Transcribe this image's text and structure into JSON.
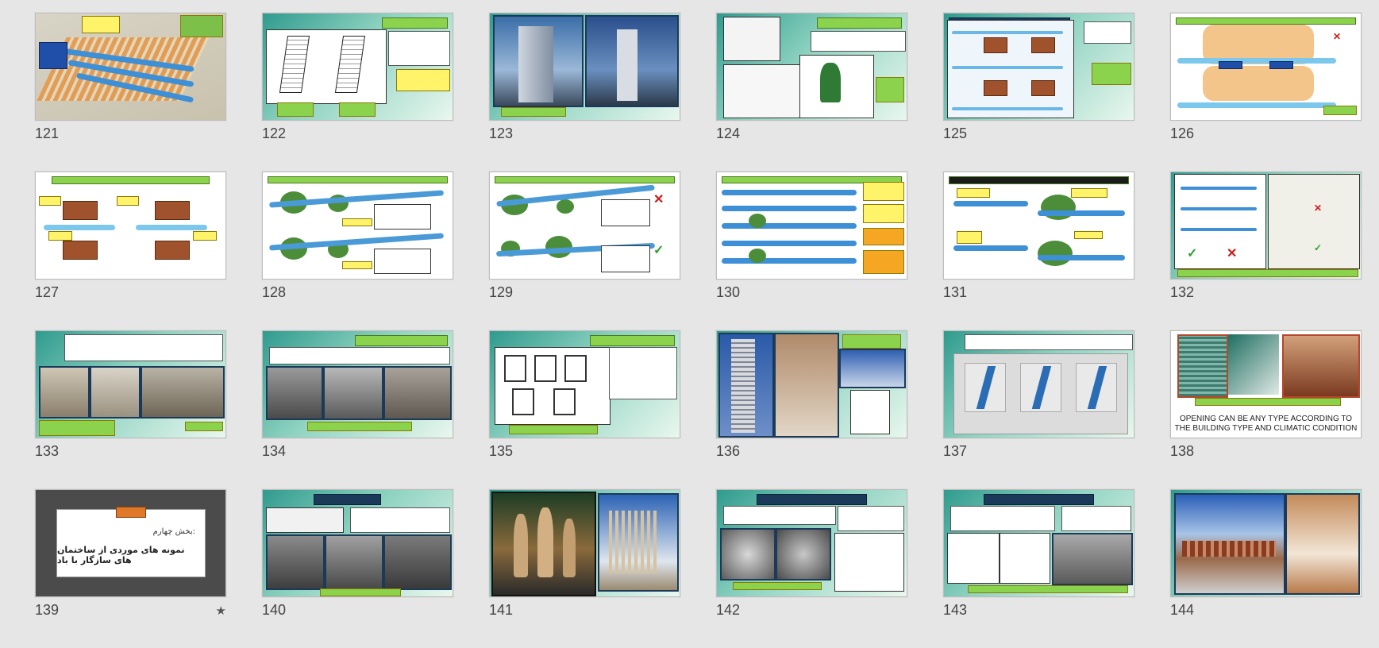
{
  "slides": [
    {
      "number": "121",
      "kind": "map"
    },
    {
      "number": "122",
      "kind": "sketch-tower"
    },
    {
      "number": "123",
      "kind": "photos-towers"
    },
    {
      "number": "124",
      "kind": "trees-building"
    },
    {
      "number": "125",
      "kind": "wind-trees"
    },
    {
      "number": "126",
      "kind": "site-plan"
    },
    {
      "number": "127",
      "kind": "plantation"
    },
    {
      "number": "128",
      "kind": "tree-section"
    },
    {
      "number": "129",
      "kind": "tree-section-check"
    },
    {
      "number": "130",
      "kind": "wind-layers"
    },
    {
      "number": "131",
      "kind": "wind-sections"
    },
    {
      "number": "132",
      "kind": "house-sections"
    },
    {
      "number": "133",
      "kind": "alley-photos"
    },
    {
      "number": "134",
      "kind": "courtyard-photos"
    },
    {
      "number": "135",
      "kind": "window-sketch"
    },
    {
      "number": "136",
      "kind": "tower-photos"
    },
    {
      "number": "137",
      "kind": "window-percent"
    },
    {
      "number": "138",
      "kind": "window-types",
      "caption": "OPENING CAN BE ANY TYPE ACCORDING TO THE BUILDING TYPE AND CLIMATIC CONDITION"
    },
    {
      "number": "139",
      "kind": "section-title",
      "starred": true,
      "line1": "بخش چهارم:",
      "line2": "نمونه های موردی از ساختمان های سازگار با باد"
    },
    {
      "number": "140",
      "kind": "case-photos"
    },
    {
      "number": "141",
      "kind": "photos-center"
    },
    {
      "number": "142",
      "kind": "case-sketches"
    },
    {
      "number": "143",
      "kind": "case-drawings"
    },
    {
      "number": "144",
      "kind": "photos-roof"
    }
  ],
  "icons": {
    "star": "star-icon"
  },
  "colors": {
    "background": "#e6e6e6",
    "title_green": "#8bd34c",
    "label_yellow": "#fff36a"
  }
}
